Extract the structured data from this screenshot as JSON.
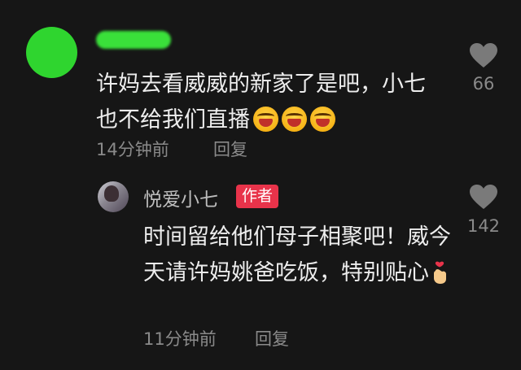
{
  "comment": {
    "text": "许妈去看威威的新家了是吧，小七也不给我们直播",
    "emoji_icon": "grinning-squint-emoji",
    "emoji_count": 3,
    "time": "14分钟前",
    "reply_label": "回复",
    "like_count": "66"
  },
  "reply": {
    "author_name": "悦爱小七",
    "author_badge": "作者",
    "text": "时间留给他们母子相聚吧！威今天请许妈姚爸吃饭，特别贴心",
    "emoji_icon": "finger-heart-emoji",
    "time": "11分钟前",
    "reply_label": "回复",
    "like_count": "142"
  },
  "colors": {
    "background": "#161616",
    "avatar_green": "#2fd52f",
    "badge_red": "#e8334a",
    "meta_gray": "#8a8a8a",
    "heart_gray": "#7a7a7a"
  }
}
